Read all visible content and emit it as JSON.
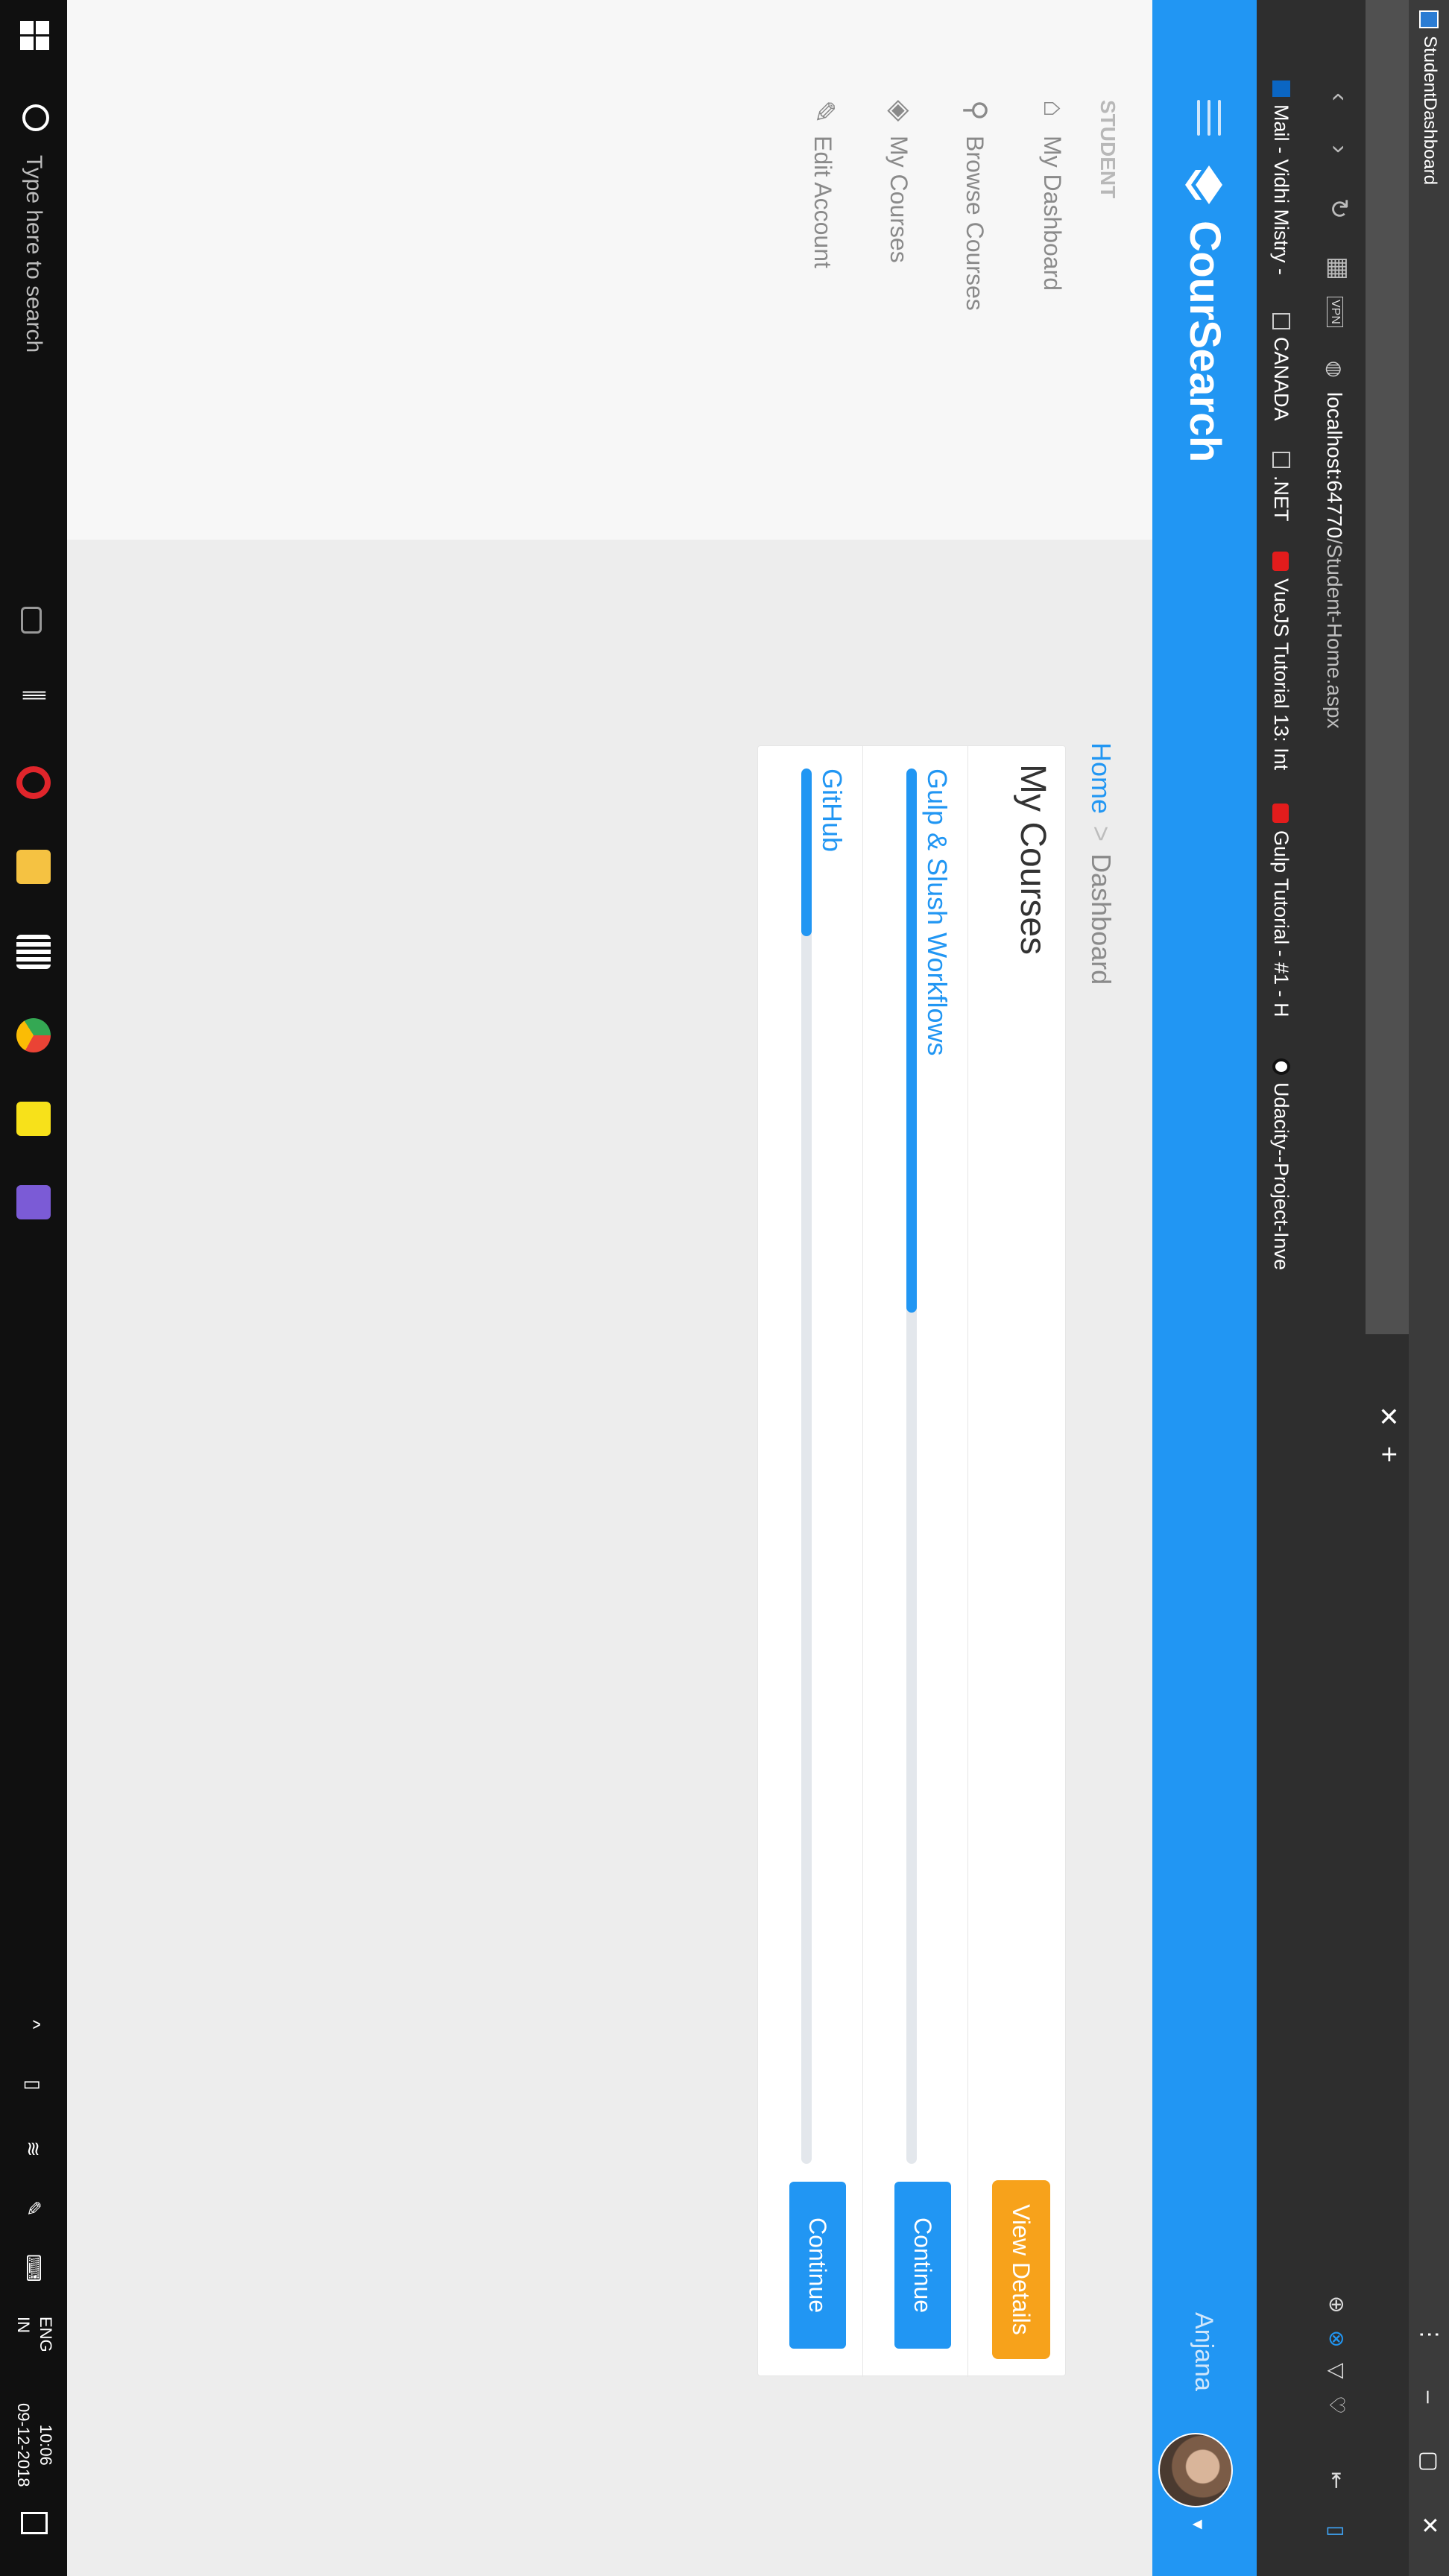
{
  "window": {
    "title": "StudentDashboard"
  },
  "browser": {
    "vpn_label": "VPN",
    "url_host": "localhost:64770",
    "url_path": "/Student-Home.aspx",
    "bookmarks": [
      {
        "label": "Mail - Vidhi Mistry - ",
        "icon": "outlook-icon"
      },
      {
        "label": "CANADA",
        "icon": "folder-icon"
      },
      {
        "label": ".NET",
        "icon": "folder-icon"
      },
      {
        "label": "VueJS Tutorial 13: Int",
        "icon": "youtube-icon"
      },
      {
        "label": "Gulp Tutorial - #1 - H",
        "icon": "youtube-icon"
      },
      {
        "label": "Udacity--Project-Inve",
        "icon": "github-icon"
      }
    ]
  },
  "app": {
    "brand": "CourSearch",
    "user_name": "Anjana",
    "colors": {
      "primary": "#2196f3",
      "accent": "#f7a21b"
    }
  },
  "sidebar": {
    "section": "STUDENT",
    "items": [
      {
        "label": "My Dashboard",
        "icon": "home-icon"
      },
      {
        "label": "Browse Courses",
        "icon": "search-icon"
      },
      {
        "label": "My Courses",
        "icon": "layers-icon"
      },
      {
        "label": "Edit Account",
        "icon": "pencil-icon"
      }
    ]
  },
  "breadcrumb": {
    "home": "Home",
    "separator": ">",
    "current": "Dashboard"
  },
  "courses_card": {
    "title": "My Courses",
    "view_details": "View Details",
    "courses": [
      {
        "name": "Gulp & Slush Workflows",
        "progress": 0.39,
        "action": "Continue"
      },
      {
        "name": "GitHub",
        "progress": 0.12,
        "action": "Continue"
      }
    ]
  },
  "taskbar": {
    "search_placeholder": "Type here to search",
    "lang_line1": "ENG",
    "lang_line2": "IN",
    "time": "10:06",
    "date": "09-12-2018"
  }
}
